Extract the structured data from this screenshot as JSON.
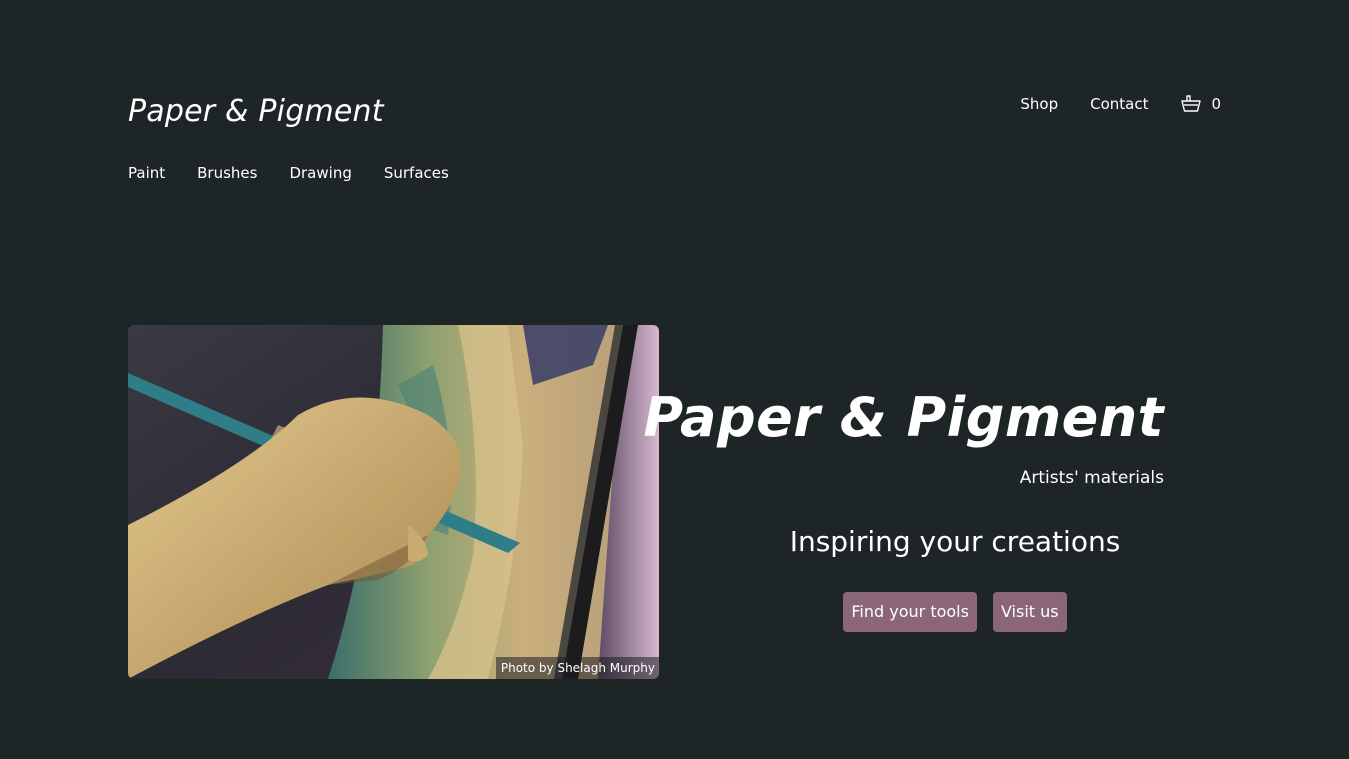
{
  "header": {
    "logo": "Paper & Pigment",
    "nav": [
      {
        "label": "Shop"
      },
      {
        "label": "Contact"
      }
    ],
    "cart": {
      "icon": "basket-icon",
      "count": "0"
    }
  },
  "categories": [
    {
      "label": "Paint"
    },
    {
      "label": "Brushes"
    },
    {
      "label": "Drawing"
    },
    {
      "label": "Surfaces"
    }
  ],
  "hero": {
    "image_description": "hand painting on canvas with brush",
    "image_credit": "Photo by Shelagh Murphy",
    "title": "Paper & Pigment",
    "subtitle": "Artists' materials",
    "tagline": "Inspiring your creations",
    "buttons": [
      {
        "label": "Find your tools"
      },
      {
        "label": "Visit us"
      }
    ]
  },
  "colors": {
    "background": "#1e2526",
    "text": "#ffffff",
    "button": "#8a6677"
  }
}
